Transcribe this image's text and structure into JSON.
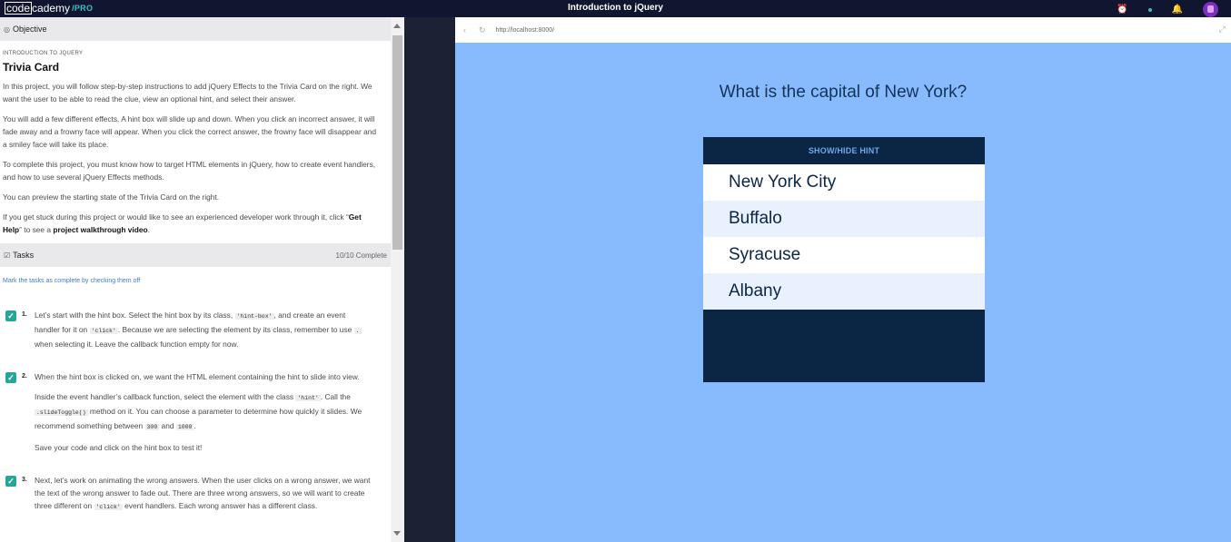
{
  "topbar": {
    "logo_code": "code",
    "logo_rest": "cademy",
    "logo_pro": "/PRO",
    "title": "Introduction to jQuery"
  },
  "objective": {
    "header": "Objective",
    "kicker": "Introduction to jQuery",
    "title": "Trivia Card",
    "p1": "In this project, you will follow step-by-step instructions to add jQuery Effects to the Trivia Card on the right. We want the user to be able to read the clue, view an optional hint, and select their answer.",
    "p2": "You will add a few different effects. A hint box will slide up and down. When you click an incorrect answer, it will fade away and a frowny face will appear. When you click the correct answer, the frowny face will disappear and a smiley face will take its place.",
    "p3": "To complete this project, you must know how to target HTML elements in jQuery, how to create event handlers, and how to use several jQuery Effects methods.",
    "p4": "You can preview the starting state of the Trivia Card on the right.",
    "p5_a": "If you get stuck during this project or would like to see an experienced developer work through it, click “",
    "p5_b": "Get Help",
    "p5_c": "” to see a ",
    "p5_d": "project walkthrough video",
    "p5_e": "."
  },
  "tasks": {
    "header": "Tasks",
    "progress": "10/10 Complete",
    "note": "Mark the tasks as complete by checking them off",
    "items": [
      {
        "num": "1.",
        "t1": "Let’s start with the hint box. Select the hint box by its class, ",
        "c1": "'hint-box'",
        "t2": ", and create an event handler for it on ",
        "c2": "'click'",
        "t3": ". Because we are selecting the element by its class, remember to use ",
        "c3": ".",
        "t4": " when selecting it. Leave the callback function empty for now."
      },
      {
        "num": "2.",
        "t1": "When the hint box is clicked on, we want the HTML element containing the hint to slide into view.",
        "p2a": "Inside the event handler’s callback function, select the element with the class ",
        "c1": "'hint'",
        "p2b": ". Call the ",
        "c2": ".slideToggle()",
        "p2c": " method on it. You can choose a parameter to determine how quickly it slides. We recommend something between ",
        "c3": "300",
        "p2d": " and ",
        "c4": "1000",
        "p2e": ".",
        "p3": "Save your code and click on the hint box to test it!"
      },
      {
        "num": "3.",
        "t1": "Next, let’s work on animating the wrong answers. When the user clicks on a wrong answer, we want the text of the wrong answer to fade out. There are three wrong answers, so we will want to create three different on ",
        "c1": "'click'",
        "t2": " event handlers. Each wrong answer has a different class."
      }
    ]
  },
  "browser": {
    "url": "http://localhost:8000/",
    "question": "What is the capital of New York?",
    "hint_label": "SHOW/HIDE HINT",
    "answers": [
      "New York City",
      "Buffalo",
      "Syracuse",
      "Albany"
    ]
  },
  "colors": {
    "topbar_bg": "#10162f",
    "card_dark": "#0b2545",
    "preview_bg": "#87bbfd",
    "check": "#26a69a"
  },
  "icons": [
    "alarm-icon",
    "status-dot-icon",
    "bell-icon",
    "avatar",
    "back-icon",
    "reload-icon",
    "expand-icon",
    "objective-icon",
    "tasks-icon",
    "check-icon"
  ]
}
